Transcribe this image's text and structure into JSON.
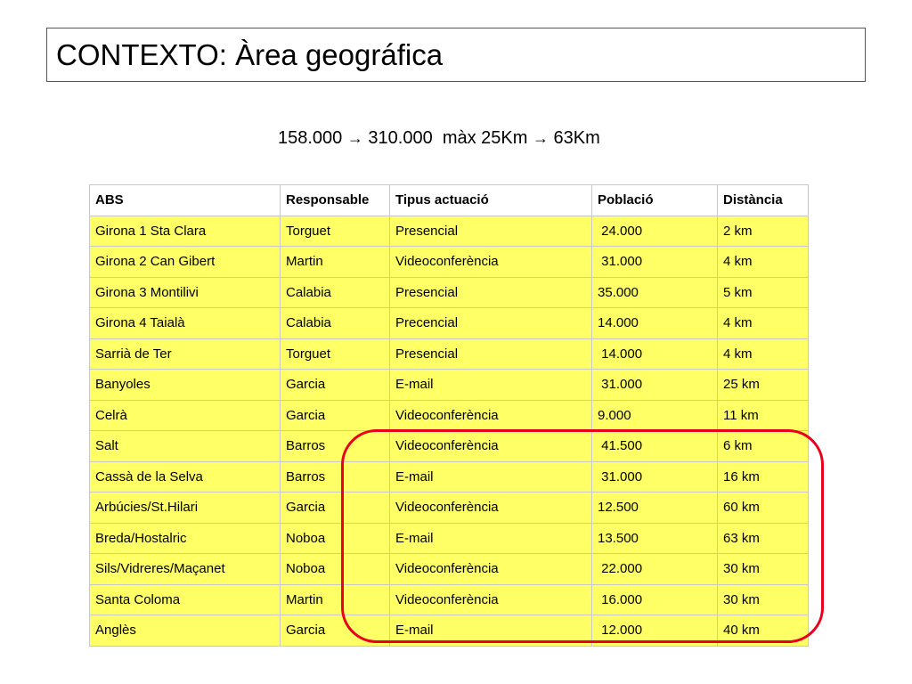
{
  "slide": {
    "title": "CONTEXTO: Àrea geográfica",
    "subtitle": {
      "part1": "158.000 ",
      "arrow": "→",
      "part2": " 310.000  màx 25Km ",
      "part3": " 63Km"
    }
  },
  "table": {
    "headers": [
      "ABS",
      "Responsable",
      "Tipus actuació",
      "Població",
      "Distància"
    ],
    "rows": [
      [
        "Girona 1 Sta Clara",
        "Torguet",
        "Presencial",
        " 24.000",
        "2 km"
      ],
      [
        "Girona 2 Can Gibert",
        "Martin",
        "Videoconferència",
        " 31.000",
        "4 km"
      ],
      [
        "Girona 3 Montilivi",
        "Calabia",
        "Presencial",
        "35.000",
        "5 km"
      ],
      [
        "Girona 4 Taialà",
        "Calabia",
        "Precencial",
        "14.000",
        "4 km"
      ],
      [
        "Sarrià de Ter",
        "Torguet",
        "Presencial",
        " 14.000",
        "4 km"
      ],
      [
        "Banyoles",
        "Garcia",
        "E-mail",
        " 31.000",
        "25 km"
      ],
      [
        "Celrà",
        "Garcia",
        "Videoconferència",
        "9.000",
        "11 km"
      ],
      [
        "Salt",
        "Barros",
        "Videoconferència",
        " 41.500",
        "6 km"
      ],
      [
        "Cassà de la Selva",
        "Barros",
        "E-mail",
        " 31.000",
        "16 km"
      ],
      [
        "Arbúcies/St.Hilari",
        "Garcia",
        "Videoconferència",
        "12.500",
        "60 km"
      ],
      [
        "Breda/Hostalric",
        "Noboa",
        "E-mail",
        "13.500",
        "63 km"
      ],
      [
        "Sils/Vidreres/Maçanet",
        "Noboa",
        "Videoconferència",
        " 22.000",
        "30 km"
      ],
      [
        "Santa Coloma",
        "Martin",
        "Videoconferència",
        " 16.000",
        "30 km"
      ],
      [
        "Anglès",
        "Garcia",
        "E-mail",
        " 12.000",
        "40 km"
      ]
    ]
  },
  "colors": {
    "cell_fill": "#ffff66",
    "highlight_ring": "#e8001c"
  }
}
